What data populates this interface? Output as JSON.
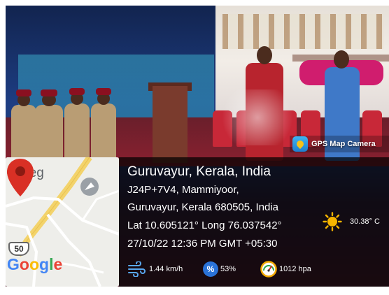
{
  "camera_label": {
    "text": "GPS Map Camera",
    "icon": "gps-map-camera-app-icon"
  },
  "map": {
    "college_label": "Colleg",
    "highway_number": "50",
    "logo_letters": [
      {
        "ch": "G",
        "color": "#4285f4"
      },
      {
        "ch": "o",
        "color": "#ea4335"
      },
      {
        "ch": "o",
        "color": "#fbbc05"
      },
      {
        "ch": "g",
        "color": "#4285f4"
      },
      {
        "ch": "l",
        "color": "#34a853"
      },
      {
        "ch": "e",
        "color": "#ea4335"
      }
    ],
    "pin_color": "#d93025"
  },
  "location": {
    "title": "Guruvayur, Kerala, India",
    "address_line1": "J24P+7V4, Mammiyoor,",
    "address_line2": "Guruvayur, Kerala 680505, India",
    "coords": "Lat 10.605121° Long 76.037542°",
    "datetime": "27/10/22 12:36 PM GMT +05:30"
  },
  "weather": {
    "temperature": "30.38° C",
    "wind": "1.44 km/h",
    "humidity": "53%",
    "humidity_symbol": "%",
    "pressure": "1012 hpa"
  },
  "colors": {
    "panel_bg": "rgba(0,0,0,0.72)",
    "text": "#ffffff",
    "humidity_icon": "#2a73d8",
    "sun": "#f7b500"
  }
}
